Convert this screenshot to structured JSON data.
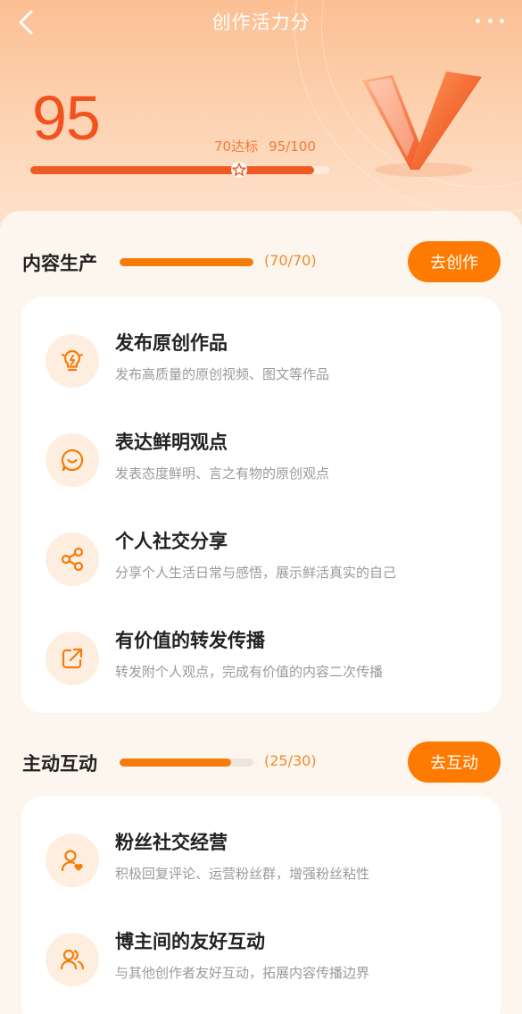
{
  "nav": {
    "title": "创作活力分"
  },
  "score": {
    "value": "95",
    "target_label": "70达标",
    "progress_text": "95/100",
    "progress_fraction": 0.95
  },
  "sections": [
    {
      "title": "内容生产",
      "count_text": "(70/70)",
      "progress_fraction": 1.0,
      "button_label": "去创作",
      "items": [
        {
          "icon": "lightbulb-icon",
          "title": "发布原创作品",
          "desc": "发布高质量的原创视频、图文等作品"
        },
        {
          "icon": "smile-chat-icon",
          "title": "表达鲜明观点",
          "desc": "发表态度鲜明、言之有物的原创观点"
        },
        {
          "icon": "share-icon",
          "title": "个人社交分享",
          "desc": "分享个人生活日常与感悟，展示鲜活真实的自己"
        },
        {
          "icon": "forward-icon",
          "title": "有价值的转发传播",
          "desc": "转发附个人观点，完成有价值的内容二次传播"
        }
      ]
    },
    {
      "title": "主动互动",
      "count_text": "(25/30)",
      "progress_fraction": 0.833,
      "button_label": "去互动",
      "items": [
        {
          "icon": "user-heart-icon",
          "title": "粉丝社交经营",
          "desc": "积极回复评论、运营粉丝群，增强粉丝粘性"
        },
        {
          "icon": "users-icon",
          "title": "博主间的友好互动",
          "desc": "与其他创作者友好互动，拓展内容传播边界"
        }
      ]
    }
  ],
  "colors": {
    "accent": "#ff7a00",
    "score": "#f2521d",
    "progress_track": "#eee4da"
  }
}
